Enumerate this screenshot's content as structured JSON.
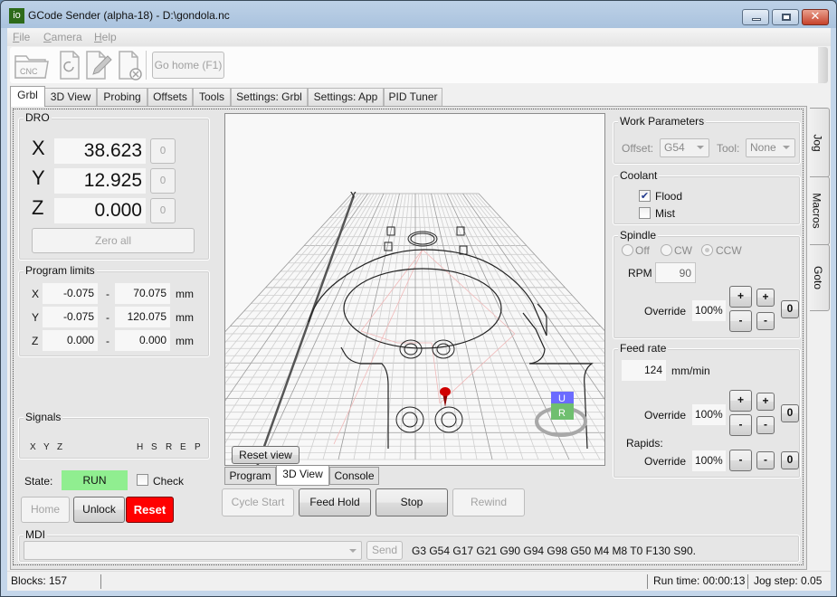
{
  "window": {
    "app_icon_text": "io",
    "title": "GCode Sender (alpha-18) - D:\\gondola.nc"
  },
  "menu": [
    "File",
    "Camera",
    "Help"
  ],
  "toolbar": {
    "icons": [
      "open-cnc-file-icon",
      "reload-icon",
      "edit-file-icon",
      "close-file-icon"
    ],
    "open_icon_label": "CNC",
    "go_home_label": "Go home (F1)"
  },
  "main_tabs": [
    {
      "label": "Grbl",
      "active": true
    },
    {
      "label": "3D View",
      "active": false
    },
    {
      "label": "Probing",
      "active": false
    },
    {
      "label": "Offsets",
      "active": false
    },
    {
      "label": "Tools",
      "active": false
    },
    {
      "label": "Settings: Grbl",
      "active": false
    },
    {
      "label": "Settings: App",
      "active": false
    },
    {
      "label": "PID Tuner",
      "active": false
    }
  ],
  "dro": {
    "title": "DRO",
    "axes": [
      {
        "axis": "X",
        "value": "38.623",
        "zero_label": "0"
      },
      {
        "axis": "Y",
        "value": "12.925",
        "zero_label": "0"
      },
      {
        "axis": "Z",
        "value": "0.000",
        "zero_label": "0"
      }
    ],
    "zero_all_label": "Zero all"
  },
  "program_limits": {
    "title": "Program limits",
    "rows": [
      {
        "axis": "X",
        "min": "-0.075",
        "sep": "-",
        "max": "70.075",
        "unit": "mm"
      },
      {
        "axis": "Y",
        "min": "-0.075",
        "sep": "-",
        "max": "120.075",
        "unit": "mm"
      },
      {
        "axis": "Z",
        "min": "0.000",
        "sep": "-",
        "max": "0.000",
        "unit": "mm"
      }
    ]
  },
  "signals": {
    "title": "Signals",
    "left": [
      "X",
      "Y",
      "Z"
    ],
    "right": [
      "H",
      "S",
      "R",
      "E",
      "P"
    ]
  },
  "state": {
    "label": "State:",
    "value": "RUN",
    "color": "#90ee90",
    "check_label": "Check",
    "check_checked": false
  },
  "actions": {
    "home": "Home",
    "unlock": "Unlock",
    "reset": "Reset",
    "reset_color": "#ff0000"
  },
  "viewport": {
    "axis_label": "Y",
    "reset_view_label": "Reset view",
    "cube_top": "U",
    "cube_front": "R"
  },
  "sub_tabs": [
    {
      "label": "Program",
      "active": false
    },
    {
      "label": "3D View",
      "active": true
    },
    {
      "label": "Console",
      "active": false
    }
  ],
  "run_controls": {
    "cycle_start": "Cycle Start",
    "feed_hold": "Feed Hold",
    "stop": "Stop",
    "rewind": "Rewind"
  },
  "work_params": {
    "title": "Work Parameters",
    "offset_label": "Offset:",
    "offset_value": "G54",
    "tool_label": "Tool:",
    "tool_value": "None"
  },
  "coolant": {
    "title": "Coolant",
    "flood_label": "Flood",
    "flood_checked": true,
    "mist_label": "Mist",
    "mist_checked": false
  },
  "spindle": {
    "title": "Spindle",
    "modes": [
      {
        "label": "Off",
        "selected": false
      },
      {
        "label": "CW",
        "selected": false
      },
      {
        "label": "CCW",
        "selected": true
      }
    ],
    "rpm_label": "RPM",
    "rpm_value": "90",
    "override_label": "Override",
    "override_value": "100%",
    "plus": "+",
    "minus": "-",
    "reset": "0"
  },
  "feed": {
    "title": "Feed rate",
    "value": "124",
    "unit": "mm/min",
    "override_label": "Override",
    "override_value": "100%",
    "rapids_label": "Rapids:",
    "rapids_override_label": "Override",
    "rapids_override_value": "100%",
    "plus": "+",
    "minus": "-",
    "reset": "0"
  },
  "side_tabs": [
    "Jog",
    "Macros",
    "Goto"
  ],
  "mdi": {
    "title": "MDI",
    "value": "",
    "send_label": "Send",
    "modal_state": "G3 G54 G17 G21 G90 G94 G98 G50 M4 M8 T0 F130 S90."
  },
  "status": {
    "blocks": "Blocks: 157",
    "run_time": "Run time: 00:00:13",
    "jog_step": "Jog step: 0.05"
  }
}
